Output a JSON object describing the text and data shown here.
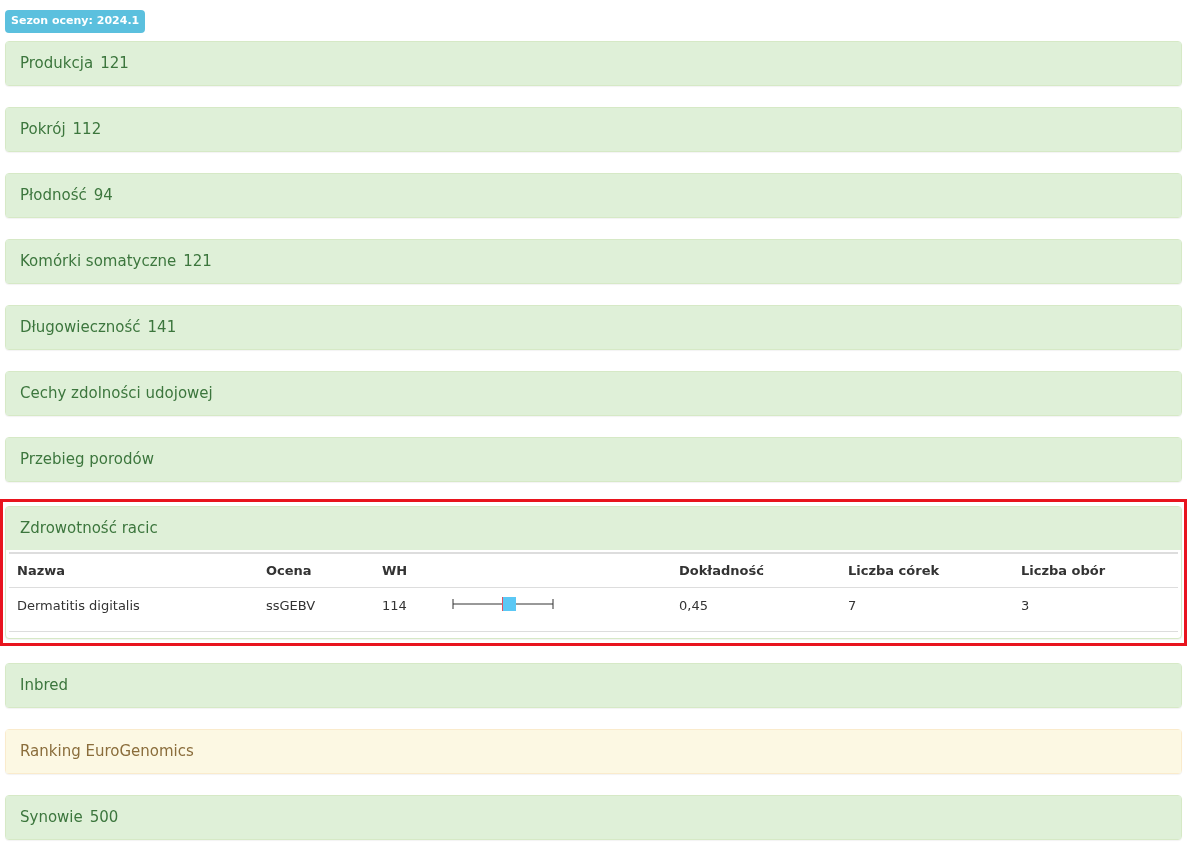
{
  "season_badge": "Sezon oceny: 2024.1",
  "panels": [
    {
      "title": "Produkcja",
      "value": "121",
      "kind": "success",
      "expanded": false,
      "highlighted": false
    },
    {
      "title": "Pokrój",
      "value": "112",
      "kind": "success",
      "expanded": false,
      "highlighted": false
    },
    {
      "title": "Płodność",
      "value": "94",
      "kind": "success",
      "expanded": false,
      "highlighted": false
    },
    {
      "title": "Komórki somatyczne",
      "value": "121",
      "kind": "success",
      "expanded": false,
      "highlighted": false
    },
    {
      "title": "Długowieczność",
      "value": "141",
      "kind": "success",
      "expanded": false,
      "highlighted": false
    },
    {
      "title": "Cechy zdolności udojowej",
      "kind": "success",
      "expanded": false,
      "highlighted": false
    },
    {
      "title": "Przebieg porodów",
      "kind": "success",
      "expanded": false,
      "highlighted": false
    },
    {
      "title": "Zdrowotność racic",
      "kind": "success",
      "expanded": true,
      "highlighted": true,
      "table": {
        "columns": [
          "Nazwa",
          "Ocena",
          "WH",
          "Dokładność",
          "Liczba córek",
          "Liczba obór"
        ],
        "rows": [
          {
            "name": "Dermatitis digitalis",
            "rating": "ssGEBV",
            "wh": "114",
            "accuracy": "0,45",
            "daughters": "7",
            "herds": "3"
          }
        ]
      }
    },
    {
      "title": "Inbred",
      "kind": "success",
      "expanded": false,
      "highlighted": false
    },
    {
      "title": "Ranking EuroGenomics",
      "kind": "warning",
      "expanded": false,
      "highlighted": false
    },
    {
      "title": "Synowie",
      "value": "500",
      "kind": "success",
      "expanded": false,
      "highlighted": false
    }
  ]
}
